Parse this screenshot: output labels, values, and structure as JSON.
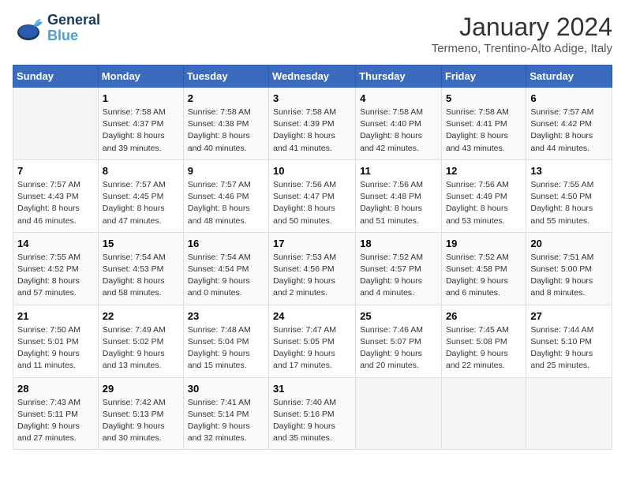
{
  "logo": {
    "text_general": "General",
    "text_blue": "Blue"
  },
  "title": "January 2024",
  "subtitle": "Termeno, Trentino-Alto Adige, Italy",
  "days_of_week": [
    "Sunday",
    "Monday",
    "Tuesday",
    "Wednesday",
    "Thursday",
    "Friday",
    "Saturday"
  ],
  "weeks": [
    [
      {
        "day": "",
        "info": ""
      },
      {
        "day": "1",
        "info": "Sunrise: 7:58 AM\nSunset: 4:37 PM\nDaylight: 8 hours\nand 39 minutes."
      },
      {
        "day": "2",
        "info": "Sunrise: 7:58 AM\nSunset: 4:38 PM\nDaylight: 8 hours\nand 40 minutes."
      },
      {
        "day": "3",
        "info": "Sunrise: 7:58 AM\nSunset: 4:39 PM\nDaylight: 8 hours\nand 41 minutes."
      },
      {
        "day": "4",
        "info": "Sunrise: 7:58 AM\nSunset: 4:40 PM\nDaylight: 8 hours\nand 42 minutes."
      },
      {
        "day": "5",
        "info": "Sunrise: 7:58 AM\nSunset: 4:41 PM\nDaylight: 8 hours\nand 43 minutes."
      },
      {
        "day": "6",
        "info": "Sunrise: 7:57 AM\nSunset: 4:42 PM\nDaylight: 8 hours\nand 44 minutes."
      }
    ],
    [
      {
        "day": "7",
        "info": "Sunrise: 7:57 AM\nSunset: 4:43 PM\nDaylight: 8 hours\nand 46 minutes."
      },
      {
        "day": "8",
        "info": "Sunrise: 7:57 AM\nSunset: 4:45 PM\nDaylight: 8 hours\nand 47 minutes."
      },
      {
        "day": "9",
        "info": "Sunrise: 7:57 AM\nSunset: 4:46 PM\nDaylight: 8 hours\nand 48 minutes."
      },
      {
        "day": "10",
        "info": "Sunrise: 7:56 AM\nSunset: 4:47 PM\nDaylight: 8 hours\nand 50 minutes."
      },
      {
        "day": "11",
        "info": "Sunrise: 7:56 AM\nSunset: 4:48 PM\nDaylight: 8 hours\nand 51 minutes."
      },
      {
        "day": "12",
        "info": "Sunrise: 7:56 AM\nSunset: 4:49 PM\nDaylight: 8 hours\nand 53 minutes."
      },
      {
        "day": "13",
        "info": "Sunrise: 7:55 AM\nSunset: 4:50 PM\nDaylight: 8 hours\nand 55 minutes."
      }
    ],
    [
      {
        "day": "14",
        "info": "Sunrise: 7:55 AM\nSunset: 4:52 PM\nDaylight: 8 hours\nand 57 minutes."
      },
      {
        "day": "15",
        "info": "Sunrise: 7:54 AM\nSunset: 4:53 PM\nDaylight: 8 hours\nand 58 minutes."
      },
      {
        "day": "16",
        "info": "Sunrise: 7:54 AM\nSunset: 4:54 PM\nDaylight: 9 hours\nand 0 minutes."
      },
      {
        "day": "17",
        "info": "Sunrise: 7:53 AM\nSunset: 4:56 PM\nDaylight: 9 hours\nand 2 minutes."
      },
      {
        "day": "18",
        "info": "Sunrise: 7:52 AM\nSunset: 4:57 PM\nDaylight: 9 hours\nand 4 minutes."
      },
      {
        "day": "19",
        "info": "Sunrise: 7:52 AM\nSunset: 4:58 PM\nDaylight: 9 hours\nand 6 minutes."
      },
      {
        "day": "20",
        "info": "Sunrise: 7:51 AM\nSunset: 5:00 PM\nDaylight: 9 hours\nand 8 minutes."
      }
    ],
    [
      {
        "day": "21",
        "info": "Sunrise: 7:50 AM\nSunset: 5:01 PM\nDaylight: 9 hours\nand 11 minutes."
      },
      {
        "day": "22",
        "info": "Sunrise: 7:49 AM\nSunset: 5:02 PM\nDaylight: 9 hours\nand 13 minutes."
      },
      {
        "day": "23",
        "info": "Sunrise: 7:48 AM\nSunset: 5:04 PM\nDaylight: 9 hours\nand 15 minutes."
      },
      {
        "day": "24",
        "info": "Sunrise: 7:47 AM\nSunset: 5:05 PM\nDaylight: 9 hours\nand 17 minutes."
      },
      {
        "day": "25",
        "info": "Sunrise: 7:46 AM\nSunset: 5:07 PM\nDaylight: 9 hours\nand 20 minutes."
      },
      {
        "day": "26",
        "info": "Sunrise: 7:45 AM\nSunset: 5:08 PM\nDaylight: 9 hours\nand 22 minutes."
      },
      {
        "day": "27",
        "info": "Sunrise: 7:44 AM\nSunset: 5:10 PM\nDaylight: 9 hours\nand 25 minutes."
      }
    ],
    [
      {
        "day": "28",
        "info": "Sunrise: 7:43 AM\nSunset: 5:11 PM\nDaylight: 9 hours\nand 27 minutes."
      },
      {
        "day": "29",
        "info": "Sunrise: 7:42 AM\nSunset: 5:13 PM\nDaylight: 9 hours\nand 30 minutes."
      },
      {
        "day": "30",
        "info": "Sunrise: 7:41 AM\nSunset: 5:14 PM\nDaylight: 9 hours\nand 32 minutes."
      },
      {
        "day": "31",
        "info": "Sunrise: 7:40 AM\nSunset: 5:16 PM\nDaylight: 9 hours\nand 35 minutes."
      },
      {
        "day": "",
        "info": ""
      },
      {
        "day": "",
        "info": ""
      },
      {
        "day": "",
        "info": ""
      }
    ]
  ]
}
